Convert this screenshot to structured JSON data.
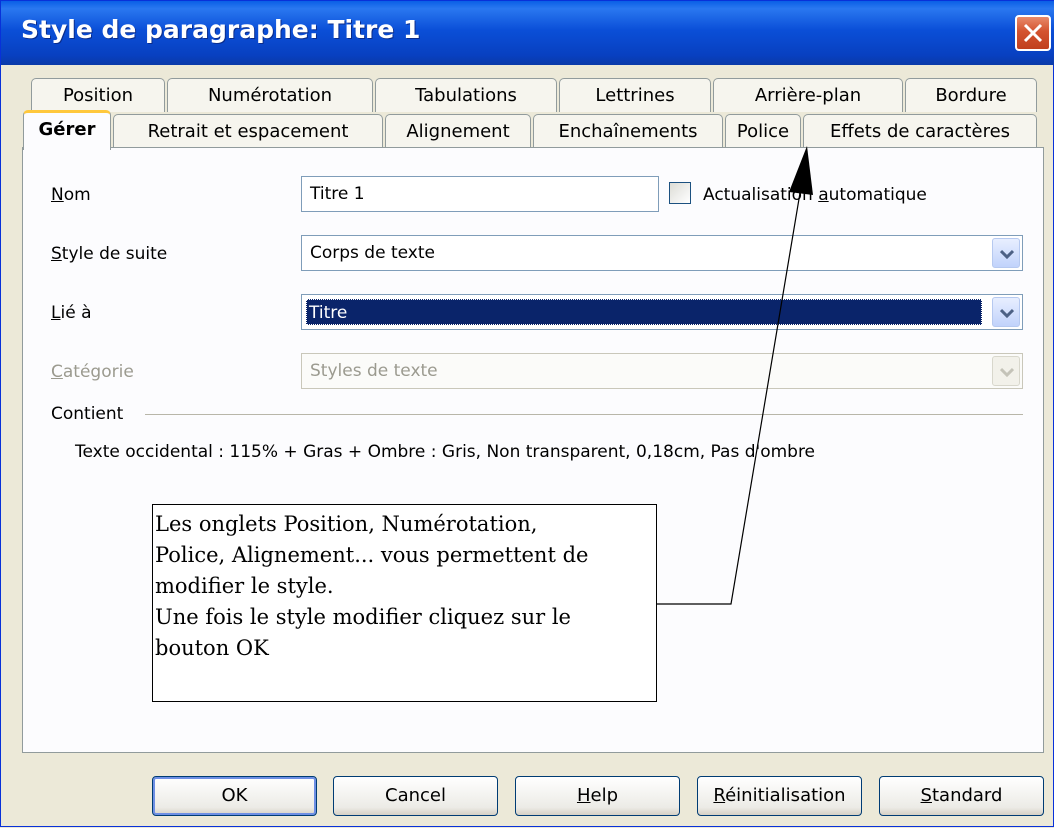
{
  "window": {
    "title": "Style de paragraphe: Titre 1"
  },
  "tabs_row1": [
    "Position",
    "Numérotation",
    "Tabulations",
    "Lettrines",
    "Arrière-plan",
    "Bordure"
  ],
  "tabs_row2": [
    "Gérer",
    "Retrait et espacement",
    "Alignement",
    "Enchaînements",
    "Police",
    "Effets de caractères"
  ],
  "form": {
    "name_label_u": "N",
    "name_label_rest": "om",
    "name_value": "Titre 1",
    "auto_update_pre": "Actualisation ",
    "auto_update_u": "a",
    "auto_update_post": "utomatique",
    "auto_update_checked": false,
    "next_label_u": "S",
    "next_label_rest": "tyle de suite",
    "next_value": "Corps de texte",
    "linked_label_u": "L",
    "linked_label_rest": "ié à",
    "linked_value": "Titre",
    "category_label_u": "C",
    "category_label_rest": "atégorie",
    "category_value": "Styles de texte"
  },
  "contains": {
    "heading": "Contient",
    "text": "Texte occidental : 115% + Gras + Ombre : Gris, Non transparent, 0,18cm, Pas d'ombre"
  },
  "annotation": {
    "lines": [
      "Les onglets Position, Numérotation,",
      "Police, Alignement... vous permettent de",
      "modifier le style.",
      "Une fois le style modifier cliquez sur le",
      "bouton OK"
    ]
  },
  "buttons": {
    "ok": "OK",
    "cancel": "Cancel",
    "help_u": "H",
    "help_rest": "elp",
    "reset_u": "R",
    "reset_rest": "éinitialisation",
    "standard_u": "S",
    "standard_rest": "tandard"
  }
}
